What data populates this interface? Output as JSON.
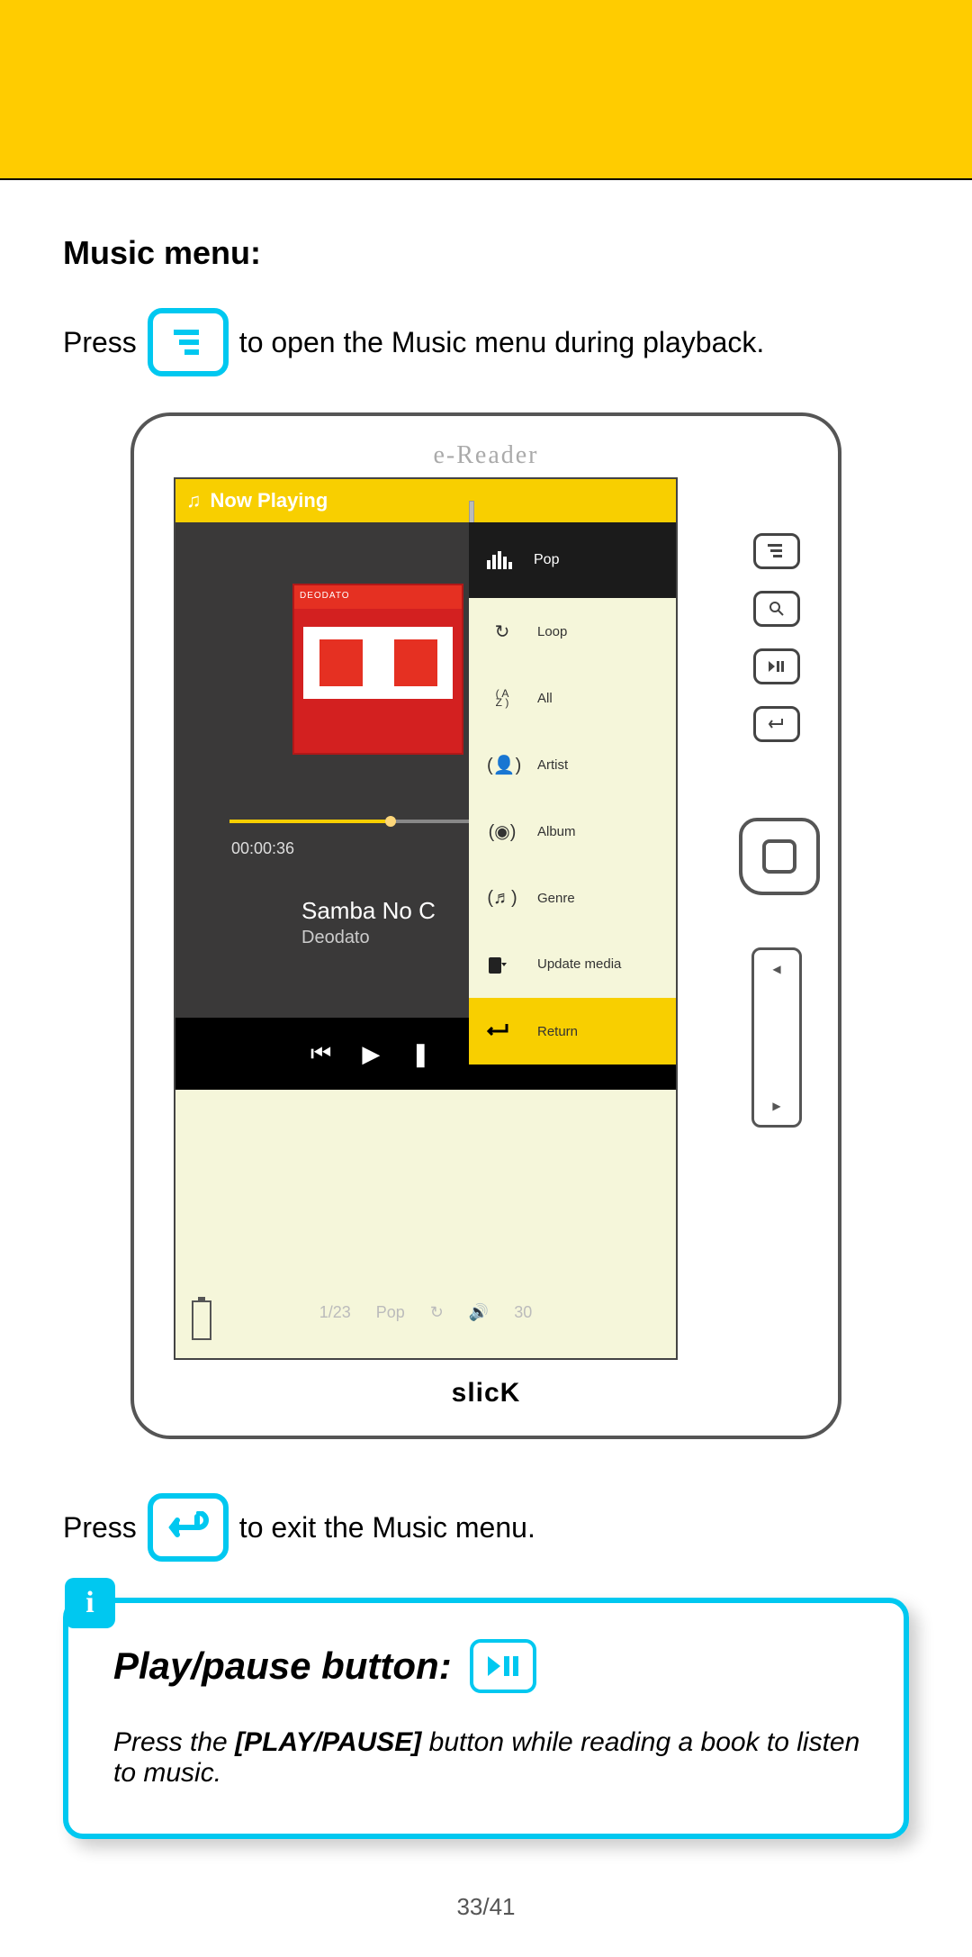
{
  "section_title": "Music menu:",
  "line1": {
    "before": "Press",
    "after": "to open the Music menu during playback."
  },
  "line2": {
    "before": "Press",
    "after": "to exit the Music menu."
  },
  "device": {
    "top_label": "e-Reader",
    "brand": "slicK",
    "now_playing_label": "Now Playing",
    "album_tag": "DEODATO",
    "timecode": "00:00:36",
    "song_title": "Samba No C",
    "artist": "Deodato",
    "footer": {
      "index": "1/23",
      "eq": "Pop",
      "volume": "30"
    },
    "menu": {
      "top": "Pop",
      "items": [
        {
          "label": "Loop"
        },
        {
          "label": "All"
        },
        {
          "label": "Artist"
        },
        {
          "label": "Album"
        },
        {
          "label": "Genre"
        },
        {
          "label": "Update media"
        },
        {
          "label": "Return"
        }
      ]
    }
  },
  "info": {
    "title": "Play/pause button:",
    "body_before": "Press the ",
    "body_bold": "[PLAY/PAUSE]",
    "body_after": " button while reading a book to listen to music."
  },
  "page_number": "33/41"
}
